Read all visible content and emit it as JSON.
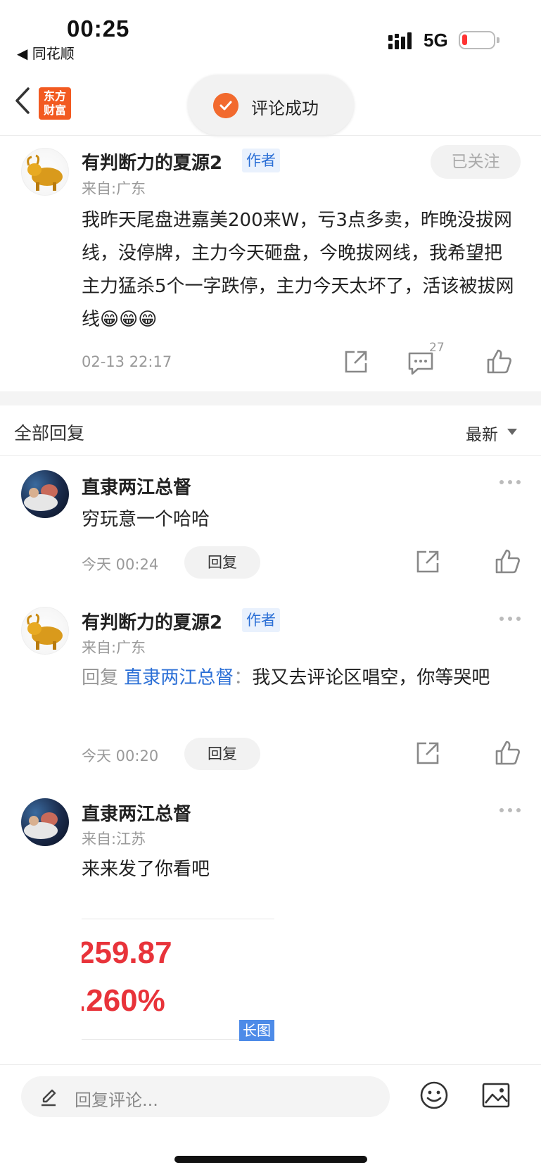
{
  "status_bar": {
    "time": "00:25",
    "back_app": "◀ 同花顺",
    "network": "5G"
  },
  "nav": {
    "logo_line1": "东方",
    "logo_line2": "财富",
    "toast": "评论成功"
  },
  "post": {
    "author": "有判断力的夏源2",
    "author_tag": "作者",
    "from": "来自:广东",
    "follow": "已关注",
    "content": "我昨天尾盘进嘉美200来W，亏3点多卖，昨晚没拔网线，没停牌，主力今天砸盘，今晚拔网线，我希望把主力猛杀5个一字跌停，主力今天太坏了，活该被拔网线😁😁😁",
    "time": "02-13 22:17",
    "comment_count": "27"
  },
  "replies_header": {
    "title": "全部回复",
    "sort": "最新"
  },
  "replies": [
    {
      "name": "直隶两江总督",
      "content": "穷玩意一个哈哈",
      "time": "今天 00:24",
      "reply_label": "回复"
    },
    {
      "name": "有判断力的夏源2",
      "author_tag": "作者",
      "from": "来自:广东",
      "reply_prefix": "回复",
      "reply_to": "直隶两江总督",
      "separator": "：",
      "content": "我又去评论区唱空，你等哭吧",
      "time": "今天 00:20",
      "reply_label": "回复"
    },
    {
      "name": "直隶两江总督",
      "from": "来自:江苏",
      "content": "来来发了你看吧",
      "image_value1": "259.87",
      "image_value2": ".260%",
      "image_tag": "长图"
    }
  ],
  "bottom_bar": {
    "placeholder": "回复评论..."
  },
  "colors": {
    "accent_blue": "#2b6fd6",
    "brand_orange": "#f25a21",
    "stock_red": "#e8333a"
  }
}
